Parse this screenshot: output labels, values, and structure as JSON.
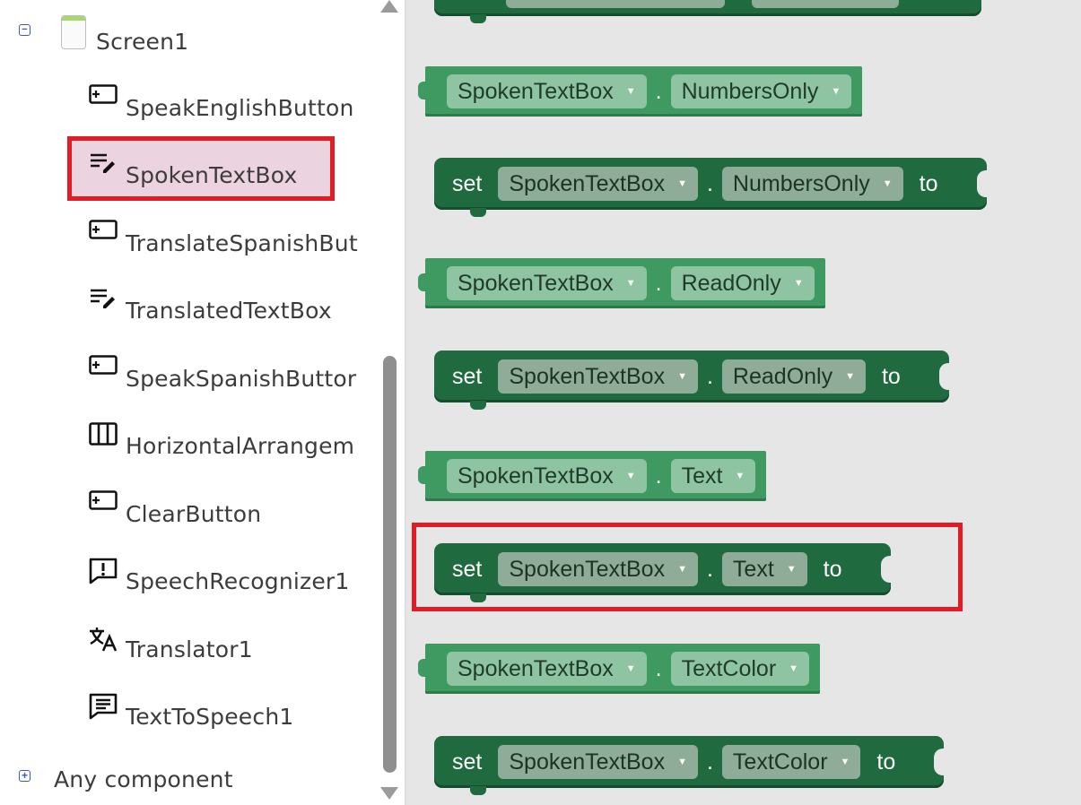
{
  "tree": {
    "root_label": "Screen1",
    "root_toggle": "⊖",
    "items": [
      {
        "label": "SpeakEnglishButton",
        "icon": "button-icon"
      },
      {
        "label": "SpokenTextBox",
        "icon": "textbox-icon",
        "selected": true
      },
      {
        "label": "TranslateSpanishBut",
        "icon": "button-icon"
      },
      {
        "label": "TranslatedTextBox",
        "icon": "textbox-icon"
      },
      {
        "label": "SpeakSpanishButtor",
        "icon": "button-icon"
      },
      {
        "label": "HorizontalArrangem",
        "icon": "horizontal-arrangement-icon"
      },
      {
        "label": "ClearButton",
        "icon": "button-icon"
      },
      {
        "label": "SpeechRecognizer1",
        "icon": "speech-recognizer-icon"
      },
      {
        "label": "Translator1",
        "icon": "translator-icon"
      },
      {
        "label": "TextToSpeech1",
        "icon": "text-to-speech-icon"
      }
    ],
    "any_component_label": "Any component",
    "any_component_toggle": "⊕"
  },
  "blocks": {
    "set_keyword": "set",
    "to_keyword": "to",
    "dot": ".",
    "component": "SpokenTextBox",
    "caret": "▼",
    "list": [
      {
        "kind": "getter",
        "property": "NumbersOnly"
      },
      {
        "kind": "setter",
        "property": "NumbersOnly"
      },
      {
        "kind": "getter",
        "property": "ReadOnly"
      },
      {
        "kind": "setter",
        "property": "ReadOnly"
      },
      {
        "kind": "getter",
        "property": "Text"
      },
      {
        "kind": "setter",
        "property": "Text",
        "highlighted": true
      },
      {
        "kind": "getter",
        "property": "TextColor"
      },
      {
        "kind": "setter",
        "property": "TextColor"
      }
    ]
  },
  "colors": {
    "getter_block": "#3f9a61",
    "setter_block": "#1f6a3e",
    "highlight": "#e31b23",
    "selected_row": "#ecd3e0",
    "toggle": "#3b57c8"
  }
}
